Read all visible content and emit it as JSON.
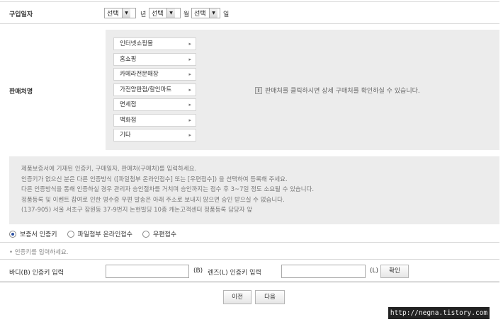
{
  "purchase_date": {
    "label": "구입일자",
    "year_select": "선택",
    "year_unit": "년",
    "month_select": "선택",
    "month_unit": "월",
    "day_select": "선택",
    "day_unit": "일"
  },
  "store": {
    "label": "판매처명",
    "items": [
      "인터넷쇼핑몰",
      "홈쇼핑",
      "카메라전문매장",
      "가전양판점/할인마트",
      "면세점",
      "백화점",
      "기타"
    ],
    "info": "판매처를 클릭하시면 상세 구매처를 확인하실 수 있습니다."
  },
  "notice": {
    "lines": [
      "제품보증서에 기재된 인증키, 구매일자, 판매처(구매처)를 입력하세요.",
      "인증키가 없으신 분은 다른 인증방식 ([파일첨부 온라인접수] 또는 [우편접수]) 을 선택하여 등록해 주세요.",
      "다른 인증방식을 통해 인증하실 경우 관리자 승인절차를 거치며 승인까지는 접수 후 3~7일 정도 소요될 수 있습니다.",
      "정품등록 및 이벤트 참여로 인한 영수증 우편 발송은 아래 주소로 보내지 않으면 승인 받으실 수 없습니다.",
      "(137-905) 서울 서초구 잠원동 37-9번지 논현빌딩 10층 캐논고객센터 정품등록 담당자 앞"
    ]
  },
  "auth_method": {
    "options": [
      "보증서 인증키",
      "파일첨부 온라인접수",
      "우편접수"
    ],
    "selected": "보증서 인증키"
  },
  "hint": "• 인증키를 입력하세요.",
  "keys": {
    "body_label": "바디(B) 인증키 입력",
    "body_value": "",
    "body_suffix": "(B)",
    "lens_label": "렌즈(L) 인증키 입력",
    "lens_value": "",
    "lens_suffix": "(L)",
    "confirm": "확인"
  },
  "nav": {
    "prev": "이전",
    "next": "다음"
  },
  "watermark": "http://negna.tistory.com"
}
